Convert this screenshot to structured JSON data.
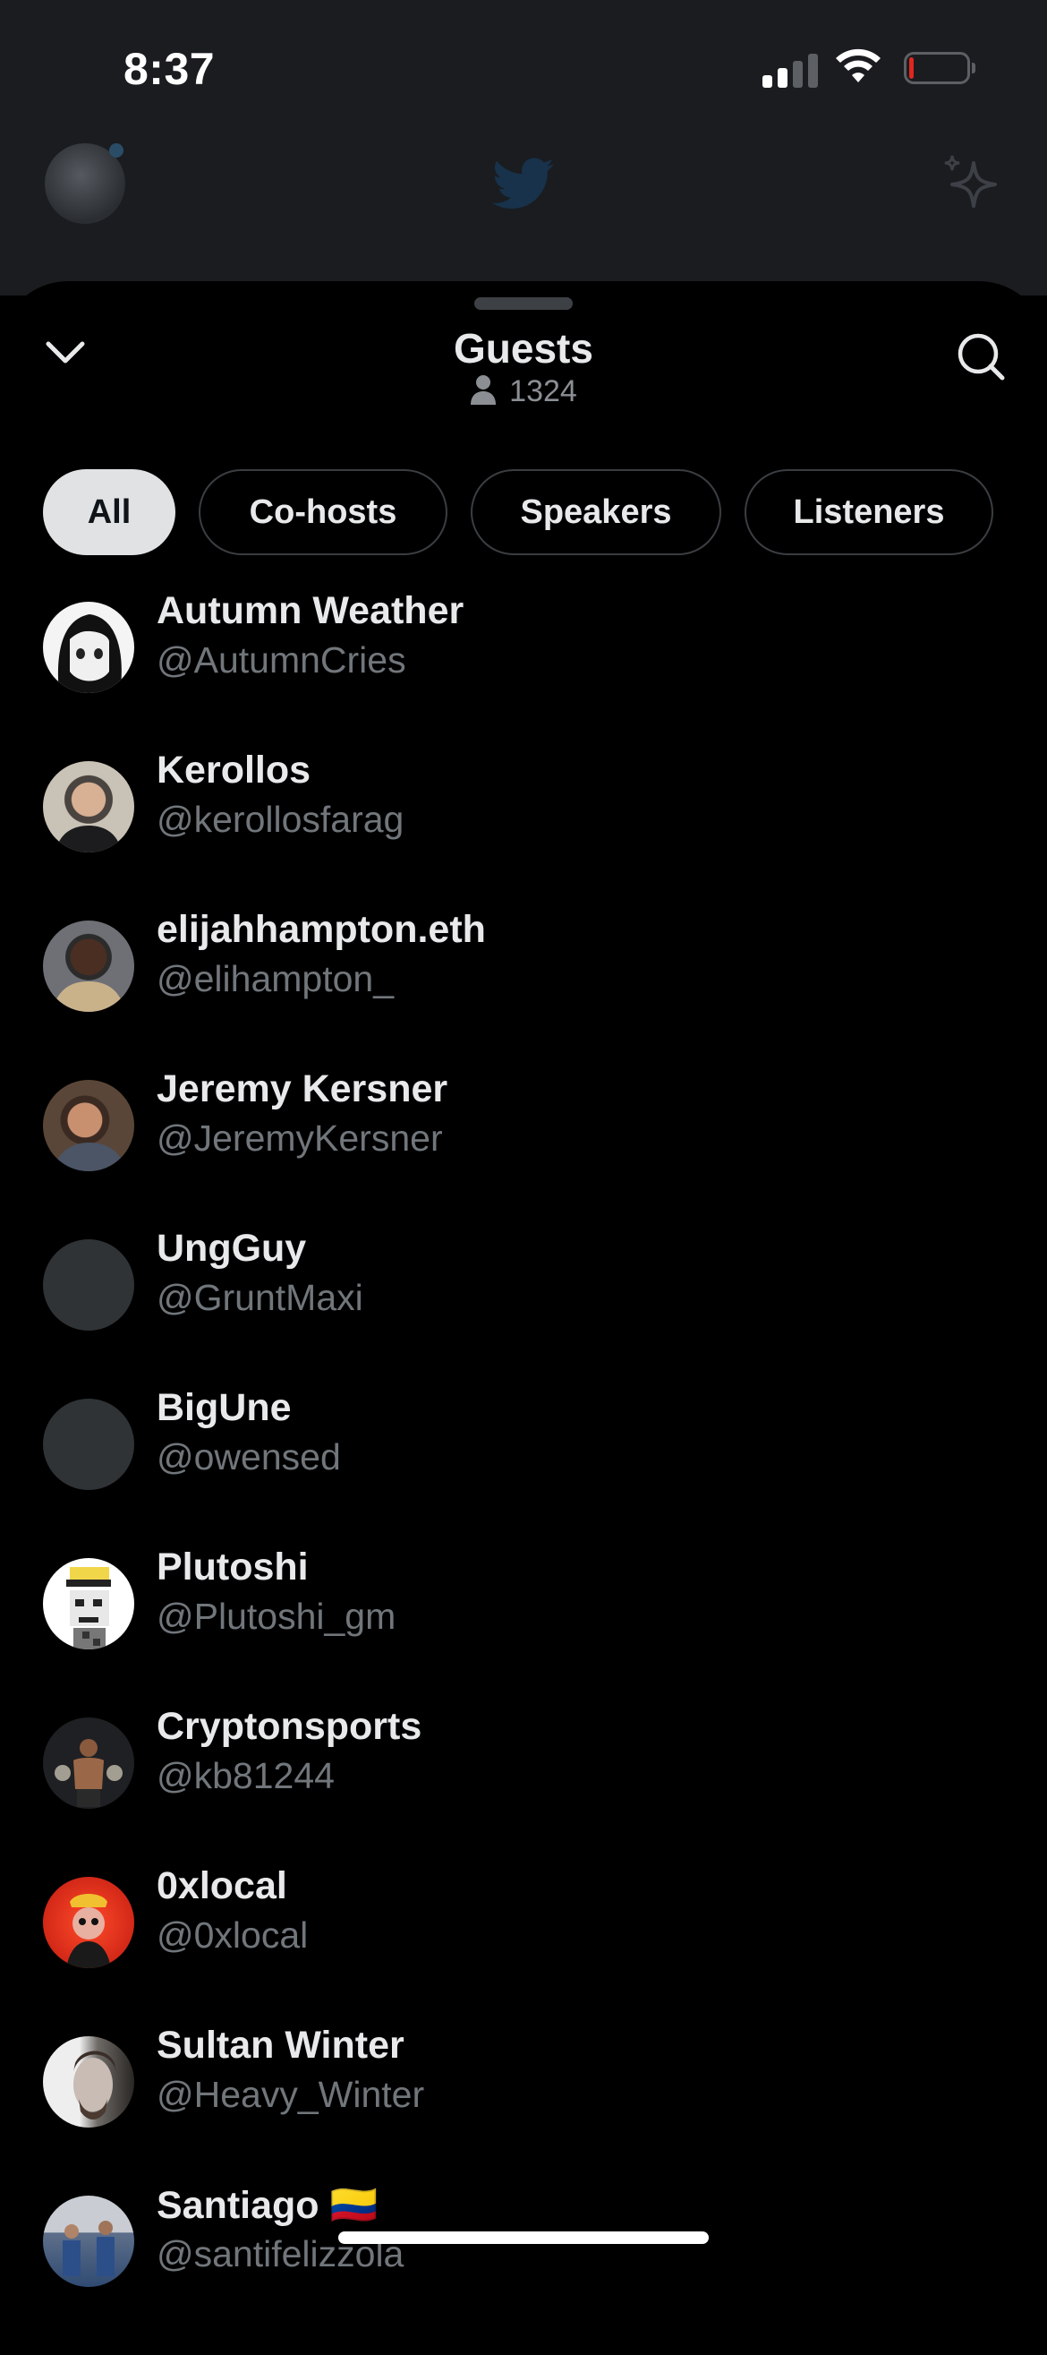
{
  "status_bar": {
    "time": "8:37",
    "battery_level": 0.08
  },
  "sheet": {
    "title": "Guests",
    "count": "1324",
    "filters": [
      {
        "label": "All",
        "active": true
      },
      {
        "label": "Co-hosts",
        "active": false
      },
      {
        "label": "Speakers",
        "active": false
      },
      {
        "label": "Listeners",
        "active": false
      }
    ]
  },
  "guests": [
    {
      "name": "Autumn Weather",
      "handle": "@AutumnCries",
      "avatar": "anime-drawing"
    },
    {
      "name": "Kerollos",
      "handle": "@kerollosfarag",
      "avatar": "photo"
    },
    {
      "name": "elijahhampton.eth",
      "handle": "@elihampton_",
      "avatar": "photo"
    },
    {
      "name": "Jeremy Kersner",
      "handle": "@JeremyKersner",
      "avatar": "photo"
    },
    {
      "name": "UngGuy",
      "handle": "@GruntMaxi",
      "avatar": "blank"
    },
    {
      "name": "BigUne",
      "handle": "@owensed",
      "avatar": "blank"
    },
    {
      "name": "Plutoshi",
      "handle": "@Plutoshi_gm",
      "avatar": "pixel-art"
    },
    {
      "name": "Cryptonsports",
      "handle": "@kb81244",
      "avatar": "photo"
    },
    {
      "name": "0xlocal",
      "handle": "@0xlocal",
      "avatar": "cartoon"
    },
    {
      "name": "Sultan Winter",
      "handle": "@Heavy_Winter",
      "avatar": "photo"
    },
    {
      "name": "Santiago 🇨🇴",
      "handle": "@santifelizzola",
      "avatar": "photo"
    }
  ],
  "colors": {
    "background": "#000000",
    "chip_active_bg": "#e0e2e4",
    "secondary_text": "#71767b",
    "battery_low": "#e0261f"
  }
}
